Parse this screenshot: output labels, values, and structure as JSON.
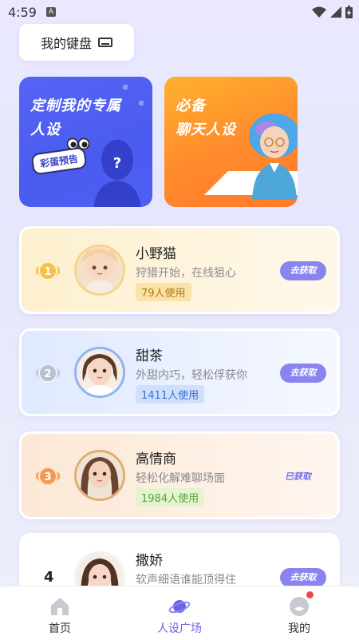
{
  "status_bar": {
    "time": "4:59",
    "notif_icon": "A"
  },
  "keyboard_button": {
    "label": "我的键盘"
  },
  "banners": {
    "left": {
      "line1": "定制我的专属",
      "line2": "人设",
      "tag": "彩蛋预告",
      "mystery": "?"
    },
    "right": {
      "line1": "必备",
      "line2": "聊天人设"
    }
  },
  "cards": [
    {
      "rank": "1",
      "name": "小野猫",
      "desc": "狩猎开始，在线狙心",
      "uses": "79人使用",
      "action": "去获取",
      "obtained": false
    },
    {
      "rank": "2",
      "name": "甜茶",
      "desc": "外甜内巧，轻松俘获你",
      "uses": "1411人使用",
      "action": "去获取",
      "obtained": false
    },
    {
      "rank": "3",
      "name": "高情商",
      "desc": "轻松化解难聊场面",
      "uses": "1984人使用",
      "action": "已获取",
      "obtained": true
    },
    {
      "rank": "4",
      "name": "撒娇",
      "desc": "软声细语谁能顶得住",
      "uses": "",
      "action": "去获取",
      "obtained": false
    }
  ],
  "tabbar": {
    "tabs": [
      {
        "label": "首页",
        "icon": "home-icon",
        "active": false
      },
      {
        "label": "人设广场",
        "icon": "planet-icon",
        "active": true
      },
      {
        "label": "我的",
        "icon": "profile-icon",
        "active": false
      }
    ]
  },
  "colors": {
    "accent": "#6a63ea",
    "button": "#8a84f0",
    "banner_blue": "#4a5bef",
    "banner_orange": "#ff8a2c"
  }
}
